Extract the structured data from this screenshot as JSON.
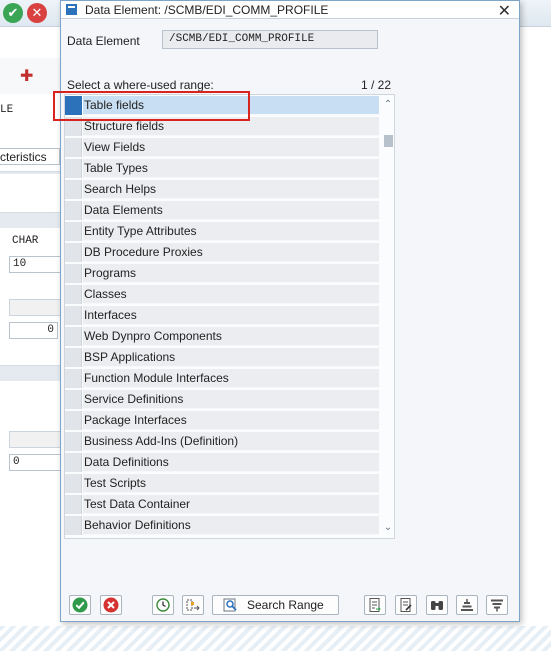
{
  "dialog": {
    "title": "Data Element: /SCMB/EDI_COMM_PROFILE",
    "data_element_label": "Data Element",
    "data_element_value": "/SCMB/EDI_COMM_PROFILE",
    "range_label": "Select a where-used range:",
    "page_count": "1 / 22",
    "items": [
      {
        "label": "Table fields",
        "selected": true
      },
      {
        "label": "Structure fields"
      },
      {
        "label": "View Fields"
      },
      {
        "label": "Table Types"
      },
      {
        "label": "Search Helps"
      },
      {
        "label": "Data Elements"
      },
      {
        "label": "Entity Type Attributes"
      },
      {
        "label": "DB Procedure Proxies"
      },
      {
        "label": "Programs"
      },
      {
        "label": "Classes"
      },
      {
        "label": "Interfaces"
      },
      {
        "label": "Web Dynpro Components"
      },
      {
        "label": "BSP Applications"
      },
      {
        "label": "Function Module Interfaces"
      },
      {
        "label": "Service Definitions"
      },
      {
        "label": "Package Interfaces"
      },
      {
        "label": "Business Add-Ins (Definition)"
      },
      {
        "label": "Data Definitions"
      },
      {
        "label": "Test Scripts"
      },
      {
        "label": "Test Data Container"
      },
      {
        "label": "Behavior Definitions"
      }
    ],
    "buttons": {
      "search_range": "Search Range"
    }
  },
  "background": {
    "cut_label_1": "LE",
    "cut_label_2": "cteristics",
    "field_char": "CHAR",
    "field_10": "10",
    "field_0a": "0",
    "field_0b": "0"
  },
  "colors": {
    "selection": "#c8def2",
    "highlight_border": "#d8231e",
    "accent": "#2b72bb"
  }
}
